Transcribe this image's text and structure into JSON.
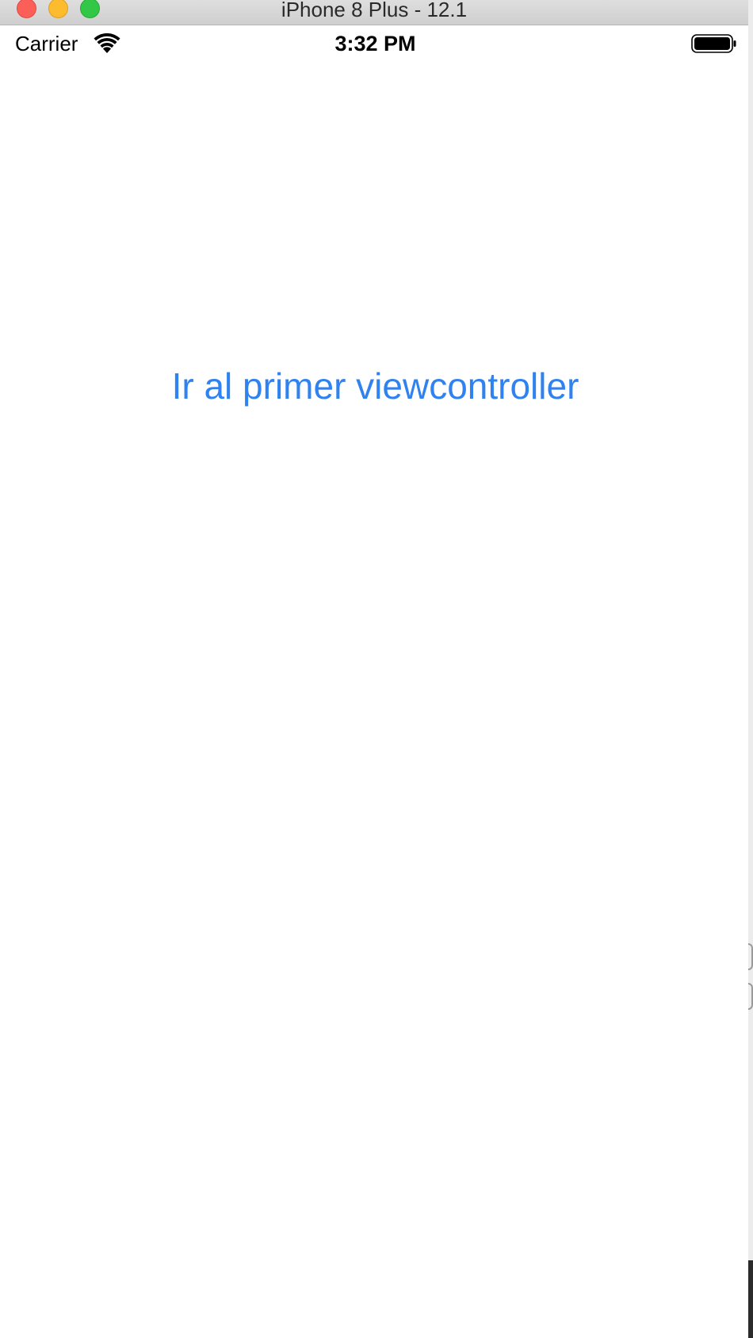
{
  "window": {
    "title": "iPhone 8 Plus - 12.1"
  },
  "status_bar": {
    "carrier": "Carrier",
    "time": "3:32 PM",
    "wifi_icon": "wifi-icon",
    "battery_icon": "battery-icon"
  },
  "main": {
    "button_label": "Ir al primer viewcontroller"
  },
  "colors": {
    "accent": "#2f82ef",
    "close": "#fc5f57",
    "minimize": "#fdbc2e",
    "maximize": "#33c748"
  }
}
